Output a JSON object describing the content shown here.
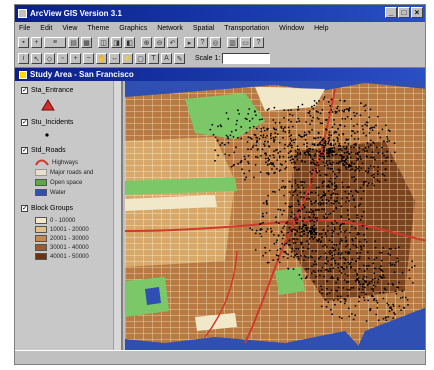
{
  "window": {
    "title": "ArcView GIS Version 3.1"
  },
  "menu": [
    "File",
    "Edit",
    "View",
    "Theme",
    "Graphics",
    "Network",
    "Spatial",
    "Transportation",
    "Window",
    "Help"
  ],
  "toolbar": {
    "scale_label": "Scale 1:"
  },
  "document": {
    "title": "Study Area - San Francisco"
  },
  "toc": {
    "layers": [
      {
        "name": "Sta_Entrance",
        "checked": true
      },
      {
        "name": "Stu_Incidents",
        "checked": true
      },
      {
        "name": "Std_Roads",
        "checked": true,
        "legend": [
          {
            "label": "Highways",
            "color": "#d03a2a"
          },
          {
            "label": "Major roads and",
            "color": "#e8e0c8"
          },
          {
            "label": "Open space",
            "color": "#5aa84a"
          },
          {
            "label": "Water",
            "color": "#2f4fb3"
          }
        ]
      },
      {
        "name": "Block Groups",
        "checked": true,
        "legend": [
          {
            "label": "0 - 10000",
            "color": "#f4e8c8"
          },
          {
            "label": "10001 - 20000",
            "color": "#e2c08a"
          },
          {
            "label": "20001 - 30000",
            "color": "#c4894e"
          },
          {
            "label": "30001 - 40000",
            "color": "#9a5c2c"
          },
          {
            "label": "40001 - 50000",
            "color": "#6a3412"
          }
        ]
      }
    ]
  },
  "colors": {
    "water": "#2f4fb3",
    "park": "#7cc868",
    "bay_shore": "#f0e8c8",
    "street": "#e8d8a8",
    "incident": "#000000"
  }
}
